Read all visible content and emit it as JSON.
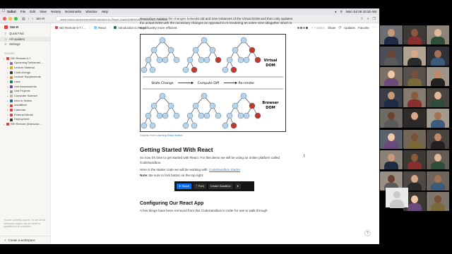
{
  "menubar": {
    "items": [
      "Safari",
      "File",
      "Edit",
      "View",
      "History",
      "Bookmarks",
      "Window",
      "Help"
    ],
    "clock": "Mon Jul 26  10:32 AM"
  },
  "browser": {
    "tab_title": "SEI-R",
    "url": "www.notion.so/seiremote/Introduction-to-React-2ca4c60f8e4e4e2f92f3f6dc023828c8c"
  },
  "sidebar": {
    "workspace": "SEI-R",
    "nav": [
      "Quick Find",
      "All Updates",
      "Settings"
    ],
    "section_label": "SHARED",
    "tree": [
      {
        "label": "SEI Remote 6-7",
        "level": 1,
        "color": "#e03e3e"
      },
      {
        "label": "Upcoming Deliverabl...",
        "level": 2,
        "color": "#9065b0"
      },
      {
        "label": "Lecture Material",
        "level": 2,
        "color": "#dfab01"
      },
      {
        "label": "Code-Alongs",
        "level": 2,
        "color": "#37352f"
      },
      {
        "label": "Lecture Supplements",
        "level": 2,
        "color": "#cb912f"
      },
      {
        "label": "Labs",
        "level": 2,
        "color": "#0f7b6c"
      },
      {
        "label": "Unit Assessments",
        "level": 2,
        "color": "#6940a5"
      },
      {
        "label": "Unit Projects",
        "level": 2,
        "color": "#9b9a97"
      },
      {
        "label": "Computer Science",
        "level": 2,
        "color": "#b4b3b0"
      },
      {
        "label": "Intro to Notion",
        "level": 2,
        "color": "#0b6e99"
      },
      {
        "label": "InstaBleet",
        "level": 2,
        "color": "#e03e3e"
      },
      {
        "label": "Calendar",
        "level": 2,
        "color": "#e03e3e"
      },
      {
        "label": "External Media",
        "level": 2,
        "color": "#e03e3e"
      },
      {
        "label": "Deployment",
        "level": 2,
        "color": "#37352f"
      },
      {
        "label": "SEI Remote (Instructor...",
        "level": 1,
        "color": "#e03e3e"
      }
    ],
    "guest_note": "You are currently a guest. To see all the workspace pages, ask an admin to upgrade you to a member.",
    "create_workspace": "Create a workspace"
  },
  "topbar": {
    "breadcrumbs": [
      "SEI Remote 6-7 / ...",
      "React",
      "Introduction to React"
    ],
    "others": "+ 7 others",
    "share": "Share",
    "updates": "Updates",
    "favorite": "Favorite"
  },
  "content": {
    "intro": "React then isolates the changes between old and new instances of the Virtual DOM and then only updates the actual DOM with the necessary changes as opposed to re-rendering an entire view altogether which is significantly more efficient.",
    "diagram": {
      "virtual_dom_label": [
        "Virtual",
        "DOM"
      ],
      "browser_dom_label": [
        "Browser",
        "DOM"
      ],
      "steps": [
        "State Change",
        "Compute Diff",
        "Re-render"
      ],
      "colors": {
        "node": "#b8d4ea",
        "changed": "#c0392b",
        "stroke": "#4a6f8a"
      }
    },
    "caption_prefix": "Graphic from ",
    "caption_link": "Learning React Native",
    "heading1": "Getting Started With React",
    "p1": "So now it's time to get started with React. For this demo we will be using an online platform called CodeSandbox.",
    "p2_prefix": "Here is the starter code we will be working with: ",
    "p2_link": "CodeSandbox Starter",
    "note_label": "Note:",
    "note_text": " Be sure to fork button on the top right:",
    "sandbox_buttons": {
      "share": "Share",
      "fork": "Fork",
      "create": "Create Sandbox"
    },
    "heading2": "Configuring Our React App",
    "p3": "A few things have been removed from this CodeSandbox in order for use to walk through"
  },
  "help": "?"
}
